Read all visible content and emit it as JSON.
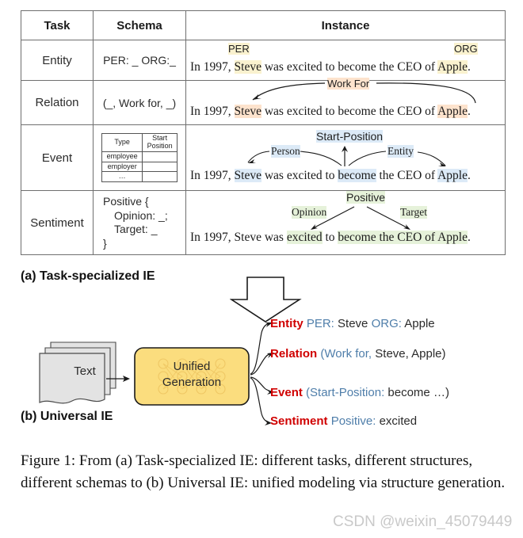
{
  "table": {
    "headers": [
      "Task",
      "Schema",
      "Instance"
    ],
    "rows": [
      {
        "task": "Entity",
        "schema_text": "PER: _ ORG:_",
        "sentence_parts": [
          "In 1997, ",
          "Steve",
          " was excited to become the CEO of ",
          "Apple",
          "."
        ],
        "labels": [
          "PER",
          "ORG"
        ]
      },
      {
        "task": "Relation",
        "schema_text": "(_, Work for, _)",
        "sentence_parts": [
          "In 1997, ",
          "Steve",
          " was excited to become the CEO of ",
          "Apple",
          "."
        ],
        "labels": [
          "Work For"
        ]
      },
      {
        "task": "Event",
        "schema_table": {
          "headers": [
            "Type",
            "Start Position"
          ],
          "rows": [
            [
              "employee",
              ""
            ],
            [
              "employer",
              ""
            ],
            [
              "…",
              ""
            ]
          ]
        },
        "sentence_parts": [
          "In 1997, ",
          "Steve",
          " was excited to ",
          "become",
          " the CEO of ",
          "Apple",
          "."
        ],
        "labels": [
          "Start-Position",
          "Person",
          "Entity"
        ]
      },
      {
        "task": "Sentiment",
        "schema_lines": [
          "Positive {",
          "Opinion: _;",
          "Target: _",
          "}"
        ],
        "sentence_parts": [
          "In 1997, Steve was ",
          "excited",
          " to ",
          "become the CEO of Apple",
          "."
        ],
        "labels": [
          "Positive",
          "Opinion",
          "Target"
        ]
      }
    ]
  },
  "captions": {
    "a": "(a) Task-specialized IE",
    "b": "(b) Universal IE"
  },
  "diagram": {
    "text_box_label": "Text",
    "model_box_label_line1": "Unified",
    "model_box_label_line2": "Generation",
    "outputs": [
      {
        "task": "Entity",
        "schema": "PER:",
        "value": "Steve",
        "schema2": "ORG:",
        "value2": "Apple"
      },
      {
        "task": "Relation",
        "schema": "(Work for,",
        "value": "Steve, Apple)"
      },
      {
        "task": "Event",
        "schema": "(Start-Position:",
        "value": "become …)"
      },
      {
        "task": "Sentiment",
        "schema": "Positive:",
        "value": "excited"
      }
    ]
  },
  "figure_caption": "Figure 1: From (a) Task-specialized IE: different tasks, different structures, different schemas to (b) Universal IE: unified modeling via structure generation.",
  "watermark": "CSDN @weixin_45079449",
  "colors": {
    "entity_highlight": "#faf2cf",
    "relation_highlight": "#fde3cd",
    "event_highlight": "#dceaf7",
    "sentiment_highlight": "#e6f2da",
    "task_red": "#d00000",
    "schema_blue": "#4f7eaa",
    "model_box": "#fbdd7e",
    "text_box": "#e3e3e3"
  }
}
